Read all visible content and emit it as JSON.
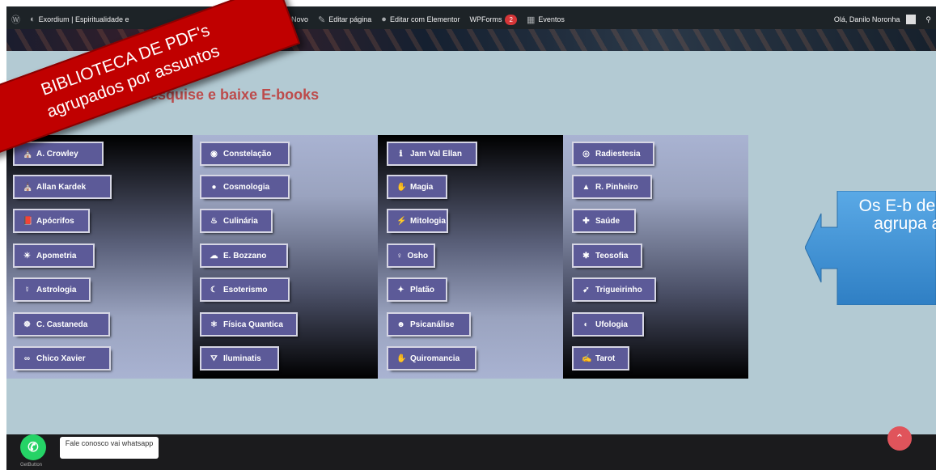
{
  "adminbar": {
    "site_name": "Exordium | Espiritualidade e",
    "new_label": "Novo",
    "edit_page_label": "Editar página",
    "elementor_label": "Editar com Elementor",
    "wpforms_label": "WPForms",
    "wpforms_count": "2",
    "events_label": "Eventos",
    "greeting": "Olá, Danilo Noronha"
  },
  "page": {
    "heading": "Pesquise e baixe E-books"
  },
  "categories": {
    "col1": [
      {
        "label": "A. Crowley",
        "icon": "⛪"
      },
      {
        "label": "Allan Kardek",
        "icon": "⛪"
      },
      {
        "label": "Apócrifos",
        "icon": "📕"
      },
      {
        "label": "Apometria",
        "icon": "☀"
      },
      {
        "label": "Astrologia",
        "icon": "☿"
      },
      {
        "label": "C. Castaneda",
        "icon": "☸"
      },
      {
        "label": "Chico Xavier",
        "icon": "∞"
      }
    ],
    "col2": [
      {
        "label": "Constelação",
        "icon": "◉"
      },
      {
        "label": "Cosmologia",
        "icon": "●"
      },
      {
        "label": "Culinária",
        "icon": "♨"
      },
      {
        "label": "E. Bozzano",
        "icon": "☁"
      },
      {
        "label": "Esoterismo",
        "icon": "☾"
      },
      {
        "label": "Física Quantica",
        "icon": "⚛"
      },
      {
        "label": "Iluminatis",
        "icon": "⛛"
      }
    ],
    "col3": [
      {
        "label": "Jam Val Ellan",
        "icon": "ℹ"
      },
      {
        "label": "Magia",
        "icon": "✋"
      },
      {
        "label": "Mitologia",
        "icon": "⚡"
      },
      {
        "label": "Osho",
        "icon": "♀"
      },
      {
        "label": "Platão",
        "icon": "✦"
      },
      {
        "label": "Psicanálise",
        "icon": "☻"
      },
      {
        "label": "Quiromancia",
        "icon": "✋"
      }
    ],
    "col4": [
      {
        "label": "Radiestesia",
        "icon": "◎"
      },
      {
        "label": "R. Pinheiro",
        "icon": "▲"
      },
      {
        "label": "Saúde",
        "icon": "✚"
      },
      {
        "label": "Teosofia",
        "icon": "✱"
      },
      {
        "label": "Trigueirinho",
        "icon": "➹"
      },
      {
        "label": "Ufologia",
        "icon": "◐"
      },
      {
        "label": "Tarot",
        "icon": "✍"
      }
    ]
  },
  "whatsapp": {
    "bubble_text": "Fale conosco vai whatsapp",
    "brand": "GetButton"
  },
  "overlays": {
    "banner_line1": "BIBLIOTECA DE PDF's",
    "banner_line2": "agrupados por assuntos",
    "callout_text": "Os E-b dentro agrupa as"
  },
  "colors": {
    "button": "#5c5a98",
    "heading": "#bd4b4b",
    "banner": "#c00000",
    "callout": "#3a8fd0",
    "background": "#b3cad3"
  }
}
